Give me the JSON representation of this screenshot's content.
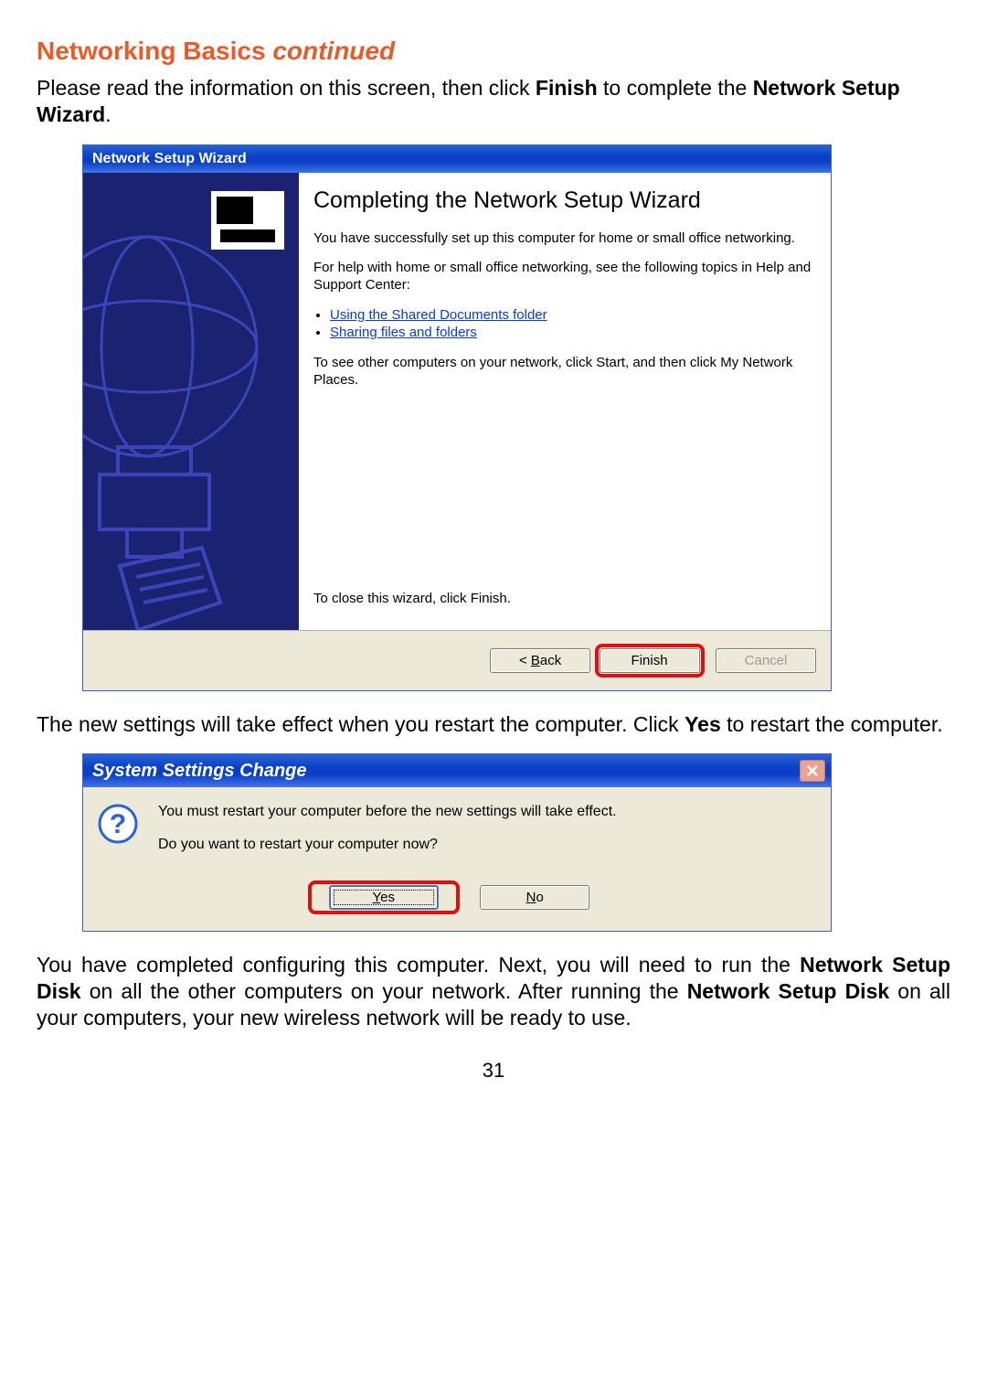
{
  "page": {
    "title_main": "Networking Basics ",
    "title_cont": "continued",
    "intro_pre": "Please read the information on this screen, then click ",
    "intro_bold1": "Finish",
    "intro_mid": " to complete the ",
    "intro_bold2": "Network Setup Wizard",
    "intro_post": ".",
    "after_wizard_pre": "The new settings will take effect when you restart the computer.  Click ",
    "after_wizard_bold": "Yes",
    "after_wizard_post": " to restart the computer.",
    "final_1": "You have completed configuring this computer. Next, you will need to run the ",
    "final_b1": "Network Setup Disk",
    "final_2": " on all the other computers on your network. After running the ",
    "final_b2": "Network Setup Disk",
    "final_3": " on all your computers, your new wireless network will be ready to use.",
    "page_number": "31"
  },
  "wizard": {
    "title": "Network Setup Wizard",
    "heading": "Completing the Network Setup Wizard",
    "p1": "You have successfully set up this computer for home or small office networking.",
    "p2": "For help with home or small office networking, see the following topics in Help and Support Center:",
    "link1": "Using the Shared Documents folder",
    "link2": "Sharing files and folders",
    "p3": "To see other computers on your network, click Start, and then click My Network Places.",
    "p_close": "To close this wizard, click Finish.",
    "btn_back_u": "B",
    "btn_back_rest": "ack",
    "btn_back_prefix": "< ",
    "btn_finish": "Finish",
    "btn_cancel": "Cancel"
  },
  "dialog": {
    "title": "System Settings Change",
    "msg1": "You must restart your computer before the new settings will take effect.",
    "msg2": "Do you want to restart your computer now?",
    "btn_yes_u": "Y",
    "btn_yes_rest": "es",
    "btn_no_u": "N",
    "btn_no_rest": "o"
  }
}
